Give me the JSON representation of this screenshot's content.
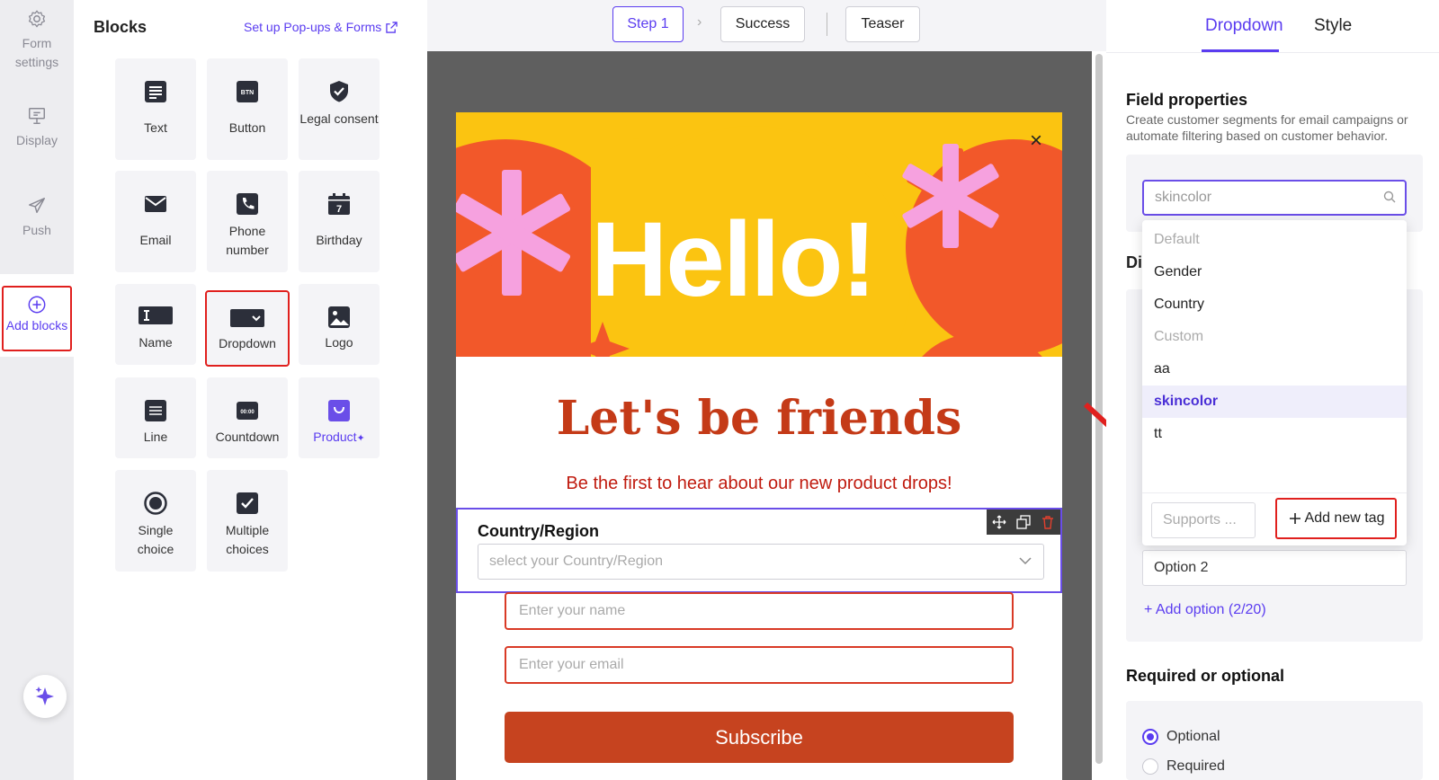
{
  "rail": {
    "form_settings": "Form settings",
    "display": "Display",
    "push": "Push",
    "add_blocks": "Add blocks"
  },
  "blocks": {
    "title": "Blocks",
    "setup_link": "Set up Pop-ups & Forms",
    "items": [
      {
        "label": "Text",
        "icon": "text-icon"
      },
      {
        "label": "Button",
        "icon": "button-icon"
      },
      {
        "label": "Legal consent",
        "icon": "shield-check-icon"
      },
      {
        "label": "Email",
        "icon": "envelope-icon"
      },
      {
        "label": "Phone number",
        "icon": "phone-icon"
      },
      {
        "label": "Birthday",
        "icon": "calendar-icon"
      },
      {
        "label": "Name",
        "icon": "name-field-icon"
      },
      {
        "label": "Dropdown",
        "icon": "dropdown-icon"
      },
      {
        "label": "Logo",
        "icon": "image-icon"
      },
      {
        "label": "Line",
        "icon": "line-icon"
      },
      {
        "label": "Countdown",
        "icon": "countdown-icon"
      },
      {
        "label": "Product",
        "icon": "bag-icon"
      },
      {
        "label": "Single choice",
        "icon": "radio-icon"
      },
      {
        "label": "Multiple choices",
        "icon": "checkbox-icon"
      }
    ]
  },
  "steps": {
    "step1": "Step 1",
    "success": "Success",
    "teaser": "Teaser"
  },
  "popup": {
    "hero_text": "Hello!",
    "close": "×",
    "headline": "Let's be friends",
    "subline": "Be the first to hear about our new product drops!",
    "country_label": "Country/Region",
    "country_placeholder": "select your Country/Region",
    "name_placeholder": "Enter your name",
    "email_placeholder": "Enter your email",
    "subscribe": "Subscribe"
  },
  "right": {
    "tab_dropdown": "Dropdown",
    "tab_style": "Style",
    "field_title": "Field properties",
    "field_desc": "Create customer segments for email campaigns or automate filtering based on customer behavior.",
    "search_value": "skincolor",
    "di_partial": "Di",
    "dropdown_items": [
      {
        "label": "Default",
        "kind": "group"
      },
      {
        "label": "Gender",
        "kind": "item"
      },
      {
        "label": "Country",
        "kind": "item"
      },
      {
        "label": "Custom",
        "kind": "group"
      },
      {
        "label": "aa",
        "kind": "item"
      },
      {
        "label": "skincolor",
        "kind": "selected"
      },
      {
        "label": "tt",
        "kind": "item"
      }
    ],
    "supports_placeholder": "Supports ...",
    "add_new_tag": "Add new tag",
    "option2": "Option 2",
    "add_option": "+ Add option (2/20)",
    "required_title": "Required or optional",
    "optional": "Optional",
    "required": "Required"
  },
  "colors": {
    "accent": "#5a3cf0",
    "highlight_red": "#e0201e",
    "hero_yellow": "#fbc411",
    "hero_orange": "#f2582a",
    "hero_pink": "#f6a1df",
    "subscribe": "#c6431f"
  }
}
